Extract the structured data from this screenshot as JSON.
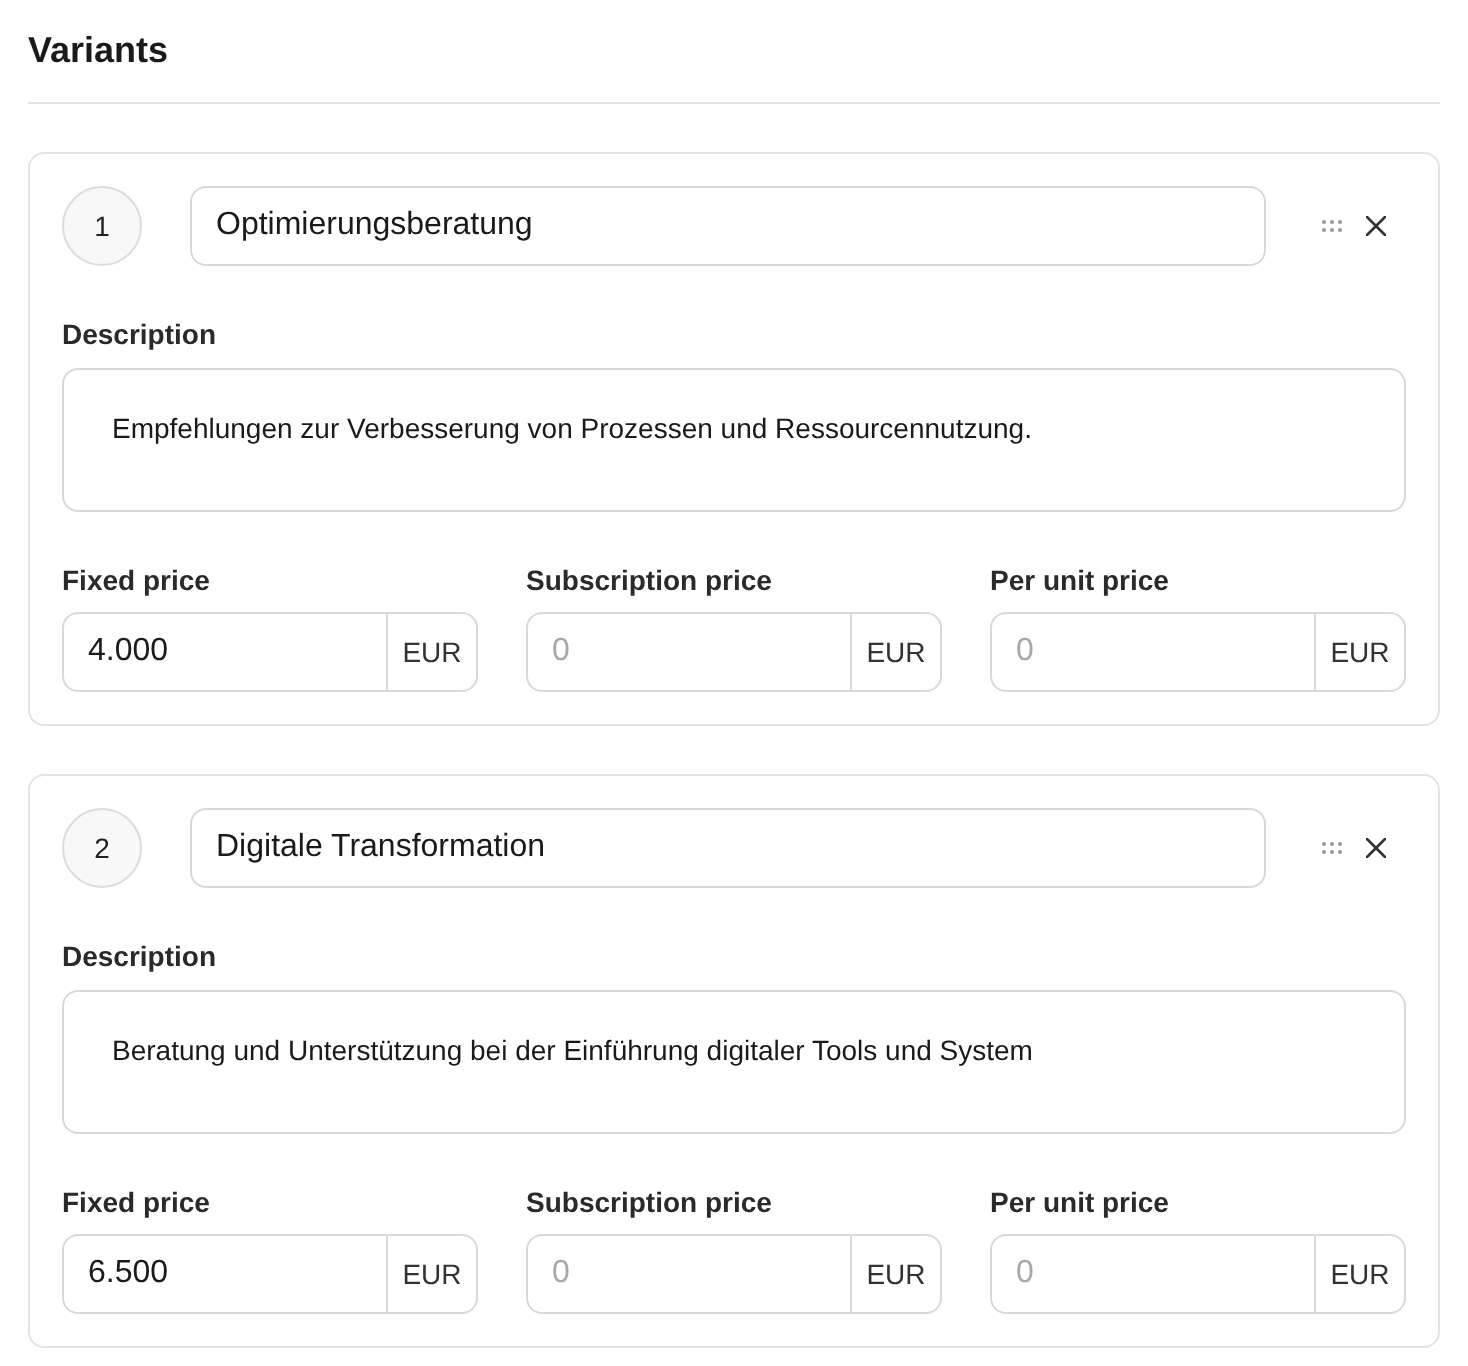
{
  "title": "Variants",
  "variants": [
    {
      "number": "1",
      "name": "Optimierungsberatung",
      "description_label": "Description",
      "description": "Empfehlungen zur Verbesserung von Prozessen und Ressourcennutzung.",
      "prices": [
        {
          "label": "Fixed price",
          "value": "4.000",
          "currency": "EUR"
        },
        {
          "label": "Subscription price",
          "placeholder": "0",
          "currency": "EUR"
        },
        {
          "label": "Per unit price",
          "placeholder": "0",
          "currency": "EUR"
        }
      ]
    },
    {
      "number": "2",
      "name": "Digitale Transformation",
      "description_label": "Description",
      "description": "Beratung und Unterstützung bei der Einführung digitaler Tools und System",
      "prices": [
        {
          "label": "Fixed price",
          "value": "6.500",
          "currency": "EUR"
        },
        {
          "label": "Subscription price",
          "placeholder": "0",
          "currency": "EUR"
        },
        {
          "label": "Per unit price",
          "placeholder": "0",
          "currency": "EUR"
        }
      ]
    }
  ]
}
